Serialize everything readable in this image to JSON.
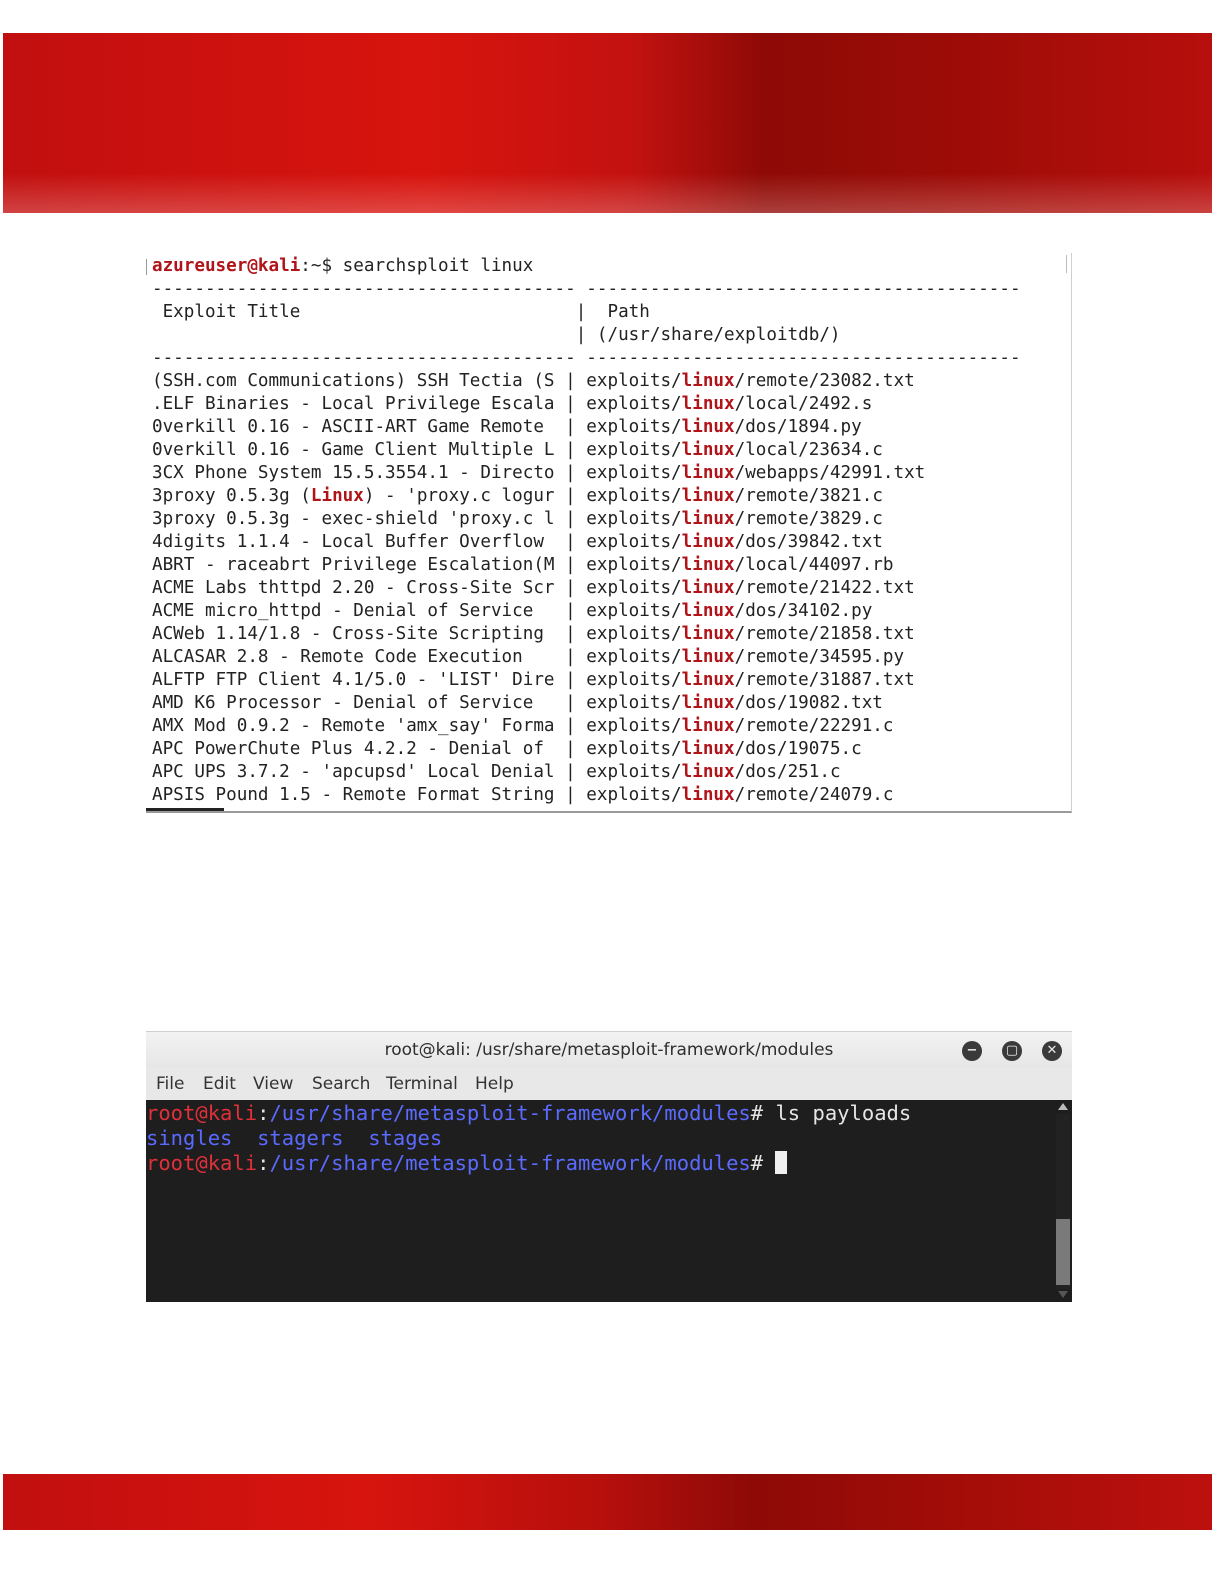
{
  "colors": {
    "banner_red": "#d8140e",
    "banner_dark": "#8e0a06",
    "highlight_red": "#b01418",
    "prompt_red": "#e0303a",
    "path_blue": "#5b6bff"
  },
  "searchsploit": {
    "prompt_user": "azureuser@kali",
    "prompt_suffix": ":~$ ",
    "command": "searchsploit linux",
    "separator_left": "----------------------------------------",
    "separator_right": "-----------------------------------------",
    "header_title": "Exploit Title",
    "header_path": "Path",
    "header_path_sub": "(/usr/share/exploitdb/)",
    "rows": [
      {
        "title": "(SSH.com Communications) SSH Tectia (S",
        "path_pre": "exploits/",
        "path_hl": "linux",
        "path_post": "/remote/23082.txt"
      },
      {
        "title": ".ELF Binaries - Local Privilege Escala",
        "path_pre": "exploits/",
        "path_hl": "linux",
        "path_post": "/local/2492.s"
      },
      {
        "title": "0verkill 0.16 - ASCII-ART Game Remote ",
        "path_pre": "exploits/",
        "path_hl": "linux",
        "path_post": "/dos/1894.py"
      },
      {
        "title": "0verkill 0.16 - Game Client Multiple L",
        "path_pre": "exploits/",
        "path_hl": "linux",
        "path_post": "/local/23634.c"
      },
      {
        "title": "3CX Phone System 15.5.3554.1 - Directo",
        "path_pre": "exploits/",
        "path_hl": "linux",
        "path_post": "/webapps/42991.txt"
      },
      {
        "title_pre": "3proxy 0.5.3g (",
        "title_hl": "Linux",
        "title_post": ") - 'proxy.c logur",
        "path_pre": "exploits/",
        "path_hl": "linux",
        "path_post": "/remote/3821.c"
      },
      {
        "title": "3proxy 0.5.3g - exec-shield 'proxy.c l",
        "path_pre": "exploits/",
        "path_hl": "linux",
        "path_post": "/remote/3829.c"
      },
      {
        "title": "4digits 1.1.4 - Local Buffer Overflow ",
        "path_pre": "exploits/",
        "path_hl": "linux",
        "path_post": "/dos/39842.txt"
      },
      {
        "title": "ABRT - raceabrt Privilege Escalation(M",
        "path_pre": "exploits/",
        "path_hl": "linux",
        "path_post": "/local/44097.rb"
      },
      {
        "title": "ACME Labs thttpd 2.20 - Cross-Site Scr",
        "path_pre": "exploits/",
        "path_hl": "linux",
        "path_post": "/remote/21422.txt"
      },
      {
        "title": "ACME micro_httpd - Denial of Service  ",
        "path_pre": "exploits/",
        "path_hl": "linux",
        "path_post": "/dos/34102.py"
      },
      {
        "title": "ACWeb 1.14/1.8 - Cross-Site Scripting ",
        "path_pre": "exploits/",
        "path_hl": "linux",
        "path_post": "/remote/21858.txt"
      },
      {
        "title": "ALCASAR 2.8 - Remote Code Execution   ",
        "path_pre": "exploits/",
        "path_hl": "linux",
        "path_post": "/remote/34595.py"
      },
      {
        "title": "ALFTP FTP Client 4.1/5.0 - 'LIST' Dire",
        "path_pre": "exploits/",
        "path_hl": "linux",
        "path_post": "/remote/31887.txt"
      },
      {
        "title": "AMD K6 Processor - Denial of Service  ",
        "path_pre": "exploits/",
        "path_hl": "linux",
        "path_post": "/dos/19082.txt"
      },
      {
        "title": "AMX Mod 0.9.2 - Remote 'amx_say' Forma",
        "path_pre": "exploits/",
        "path_hl": "linux",
        "path_post": "/remote/22291.c"
      },
      {
        "title": "APC PowerChute Plus 4.2.2 - Denial of ",
        "path_pre": "exploits/",
        "path_hl": "linux",
        "path_post": "/dos/19075.c"
      },
      {
        "title": "APC UPS 3.7.2 - 'apcupsd' Local Denial",
        "path_pre": "exploits/",
        "path_hl": "linux",
        "path_post": "/dos/251.c"
      },
      {
        "title": "APSIS Pound 1.5 - Remote Format String",
        "path_pre": "exploits/",
        "path_hl": "linux",
        "path_post": "/remote/24079.c"
      }
    ]
  },
  "terminal": {
    "title": "root@kali: /usr/share/metasploit-framework/modules",
    "menu": [
      "File",
      "Edit",
      "View",
      "Search",
      "Terminal",
      "Help"
    ],
    "prompt_user": "root@kali",
    "prompt_colon": ":",
    "prompt_path": "/usr/share/metasploit-framework/modules",
    "prompt_hash": "# ",
    "command": "ls payloads",
    "output": [
      "singles",
      "stagers",
      "stages"
    ],
    "window_buttons": [
      {
        "name": "minimize",
        "glyph": "−"
      },
      {
        "name": "maximize",
        "glyph": "▢"
      },
      {
        "name": "close",
        "glyph": "✕"
      }
    ]
  }
}
